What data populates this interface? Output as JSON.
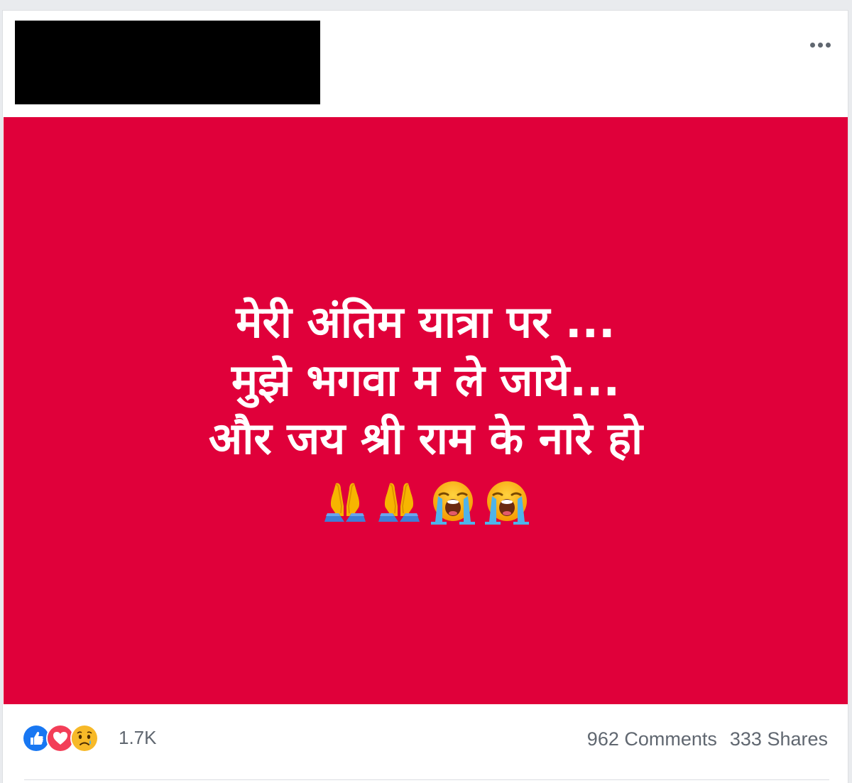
{
  "post": {
    "image_text_lines": [
      "मेरी अंतिम यात्रा पर ...",
      "मुझे भगवा म ले जाये...",
      "और जय श्री राम के नारे हो"
    ],
    "emojis": [
      "folded-hands",
      "folded-hands",
      "loudly-crying-face",
      "loudly-crying-face"
    ],
    "image_background_color": "#e0003a"
  },
  "reactions": {
    "types": [
      "like",
      "love",
      "sad"
    ],
    "count": "1.7K"
  },
  "stats": {
    "comments": "962 Comments",
    "shares": "333 Shares"
  }
}
